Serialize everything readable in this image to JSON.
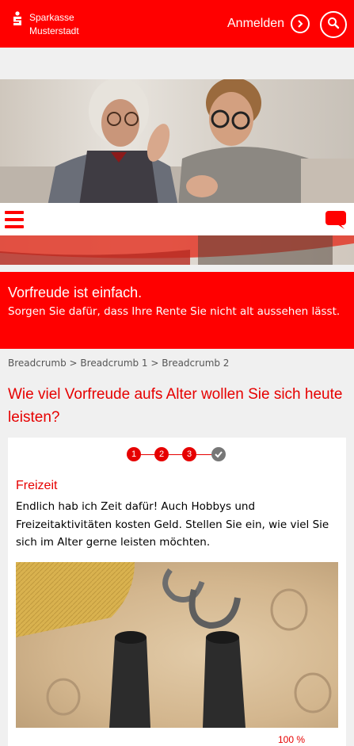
{
  "header": {
    "brand_line1": "Sparkasse",
    "brand_line2": "Musterstadt",
    "login_label": "Anmelden",
    "icons": [
      "sparkasse-s-icon",
      "chevron-right-icon",
      "search-icon"
    ]
  },
  "nav": {
    "icons": [
      "hamburger-menu-icon",
      "chat-bubble-icon"
    ]
  },
  "banner": {
    "title": "Vorfreude ist einfach.",
    "subtitle": "Sorgen Sie dafür, dass Ihre Rente Sie nicht alt aussehen lässt."
  },
  "breadcrumb": {
    "items": [
      "Breadcrumb",
      "Breadcrumb 1",
      "Breadcrumb 2"
    ],
    "separator": ">"
  },
  "page": {
    "headline": "Wie viel Vorfreude aufs Alter wollen Sie sich heute leisten?"
  },
  "wizard": {
    "steps": [
      "1",
      "2",
      "3"
    ],
    "final_step_icon": "checkmark-icon",
    "section_title": "Freizeit",
    "section_text": "Endlich hab ich Zeit dafür! Auch Hobbys und Freizeitaktivitäten kosten Geld. Stellen Sie ein, wie viel Sie sich im Alter gerne leisten möchten.",
    "percent_label": "100 %"
  },
  "colors": {
    "brand_red": "#ff0000",
    "text_red": "#e60000",
    "background": "#f0f0f0",
    "step_done": "#777777"
  }
}
